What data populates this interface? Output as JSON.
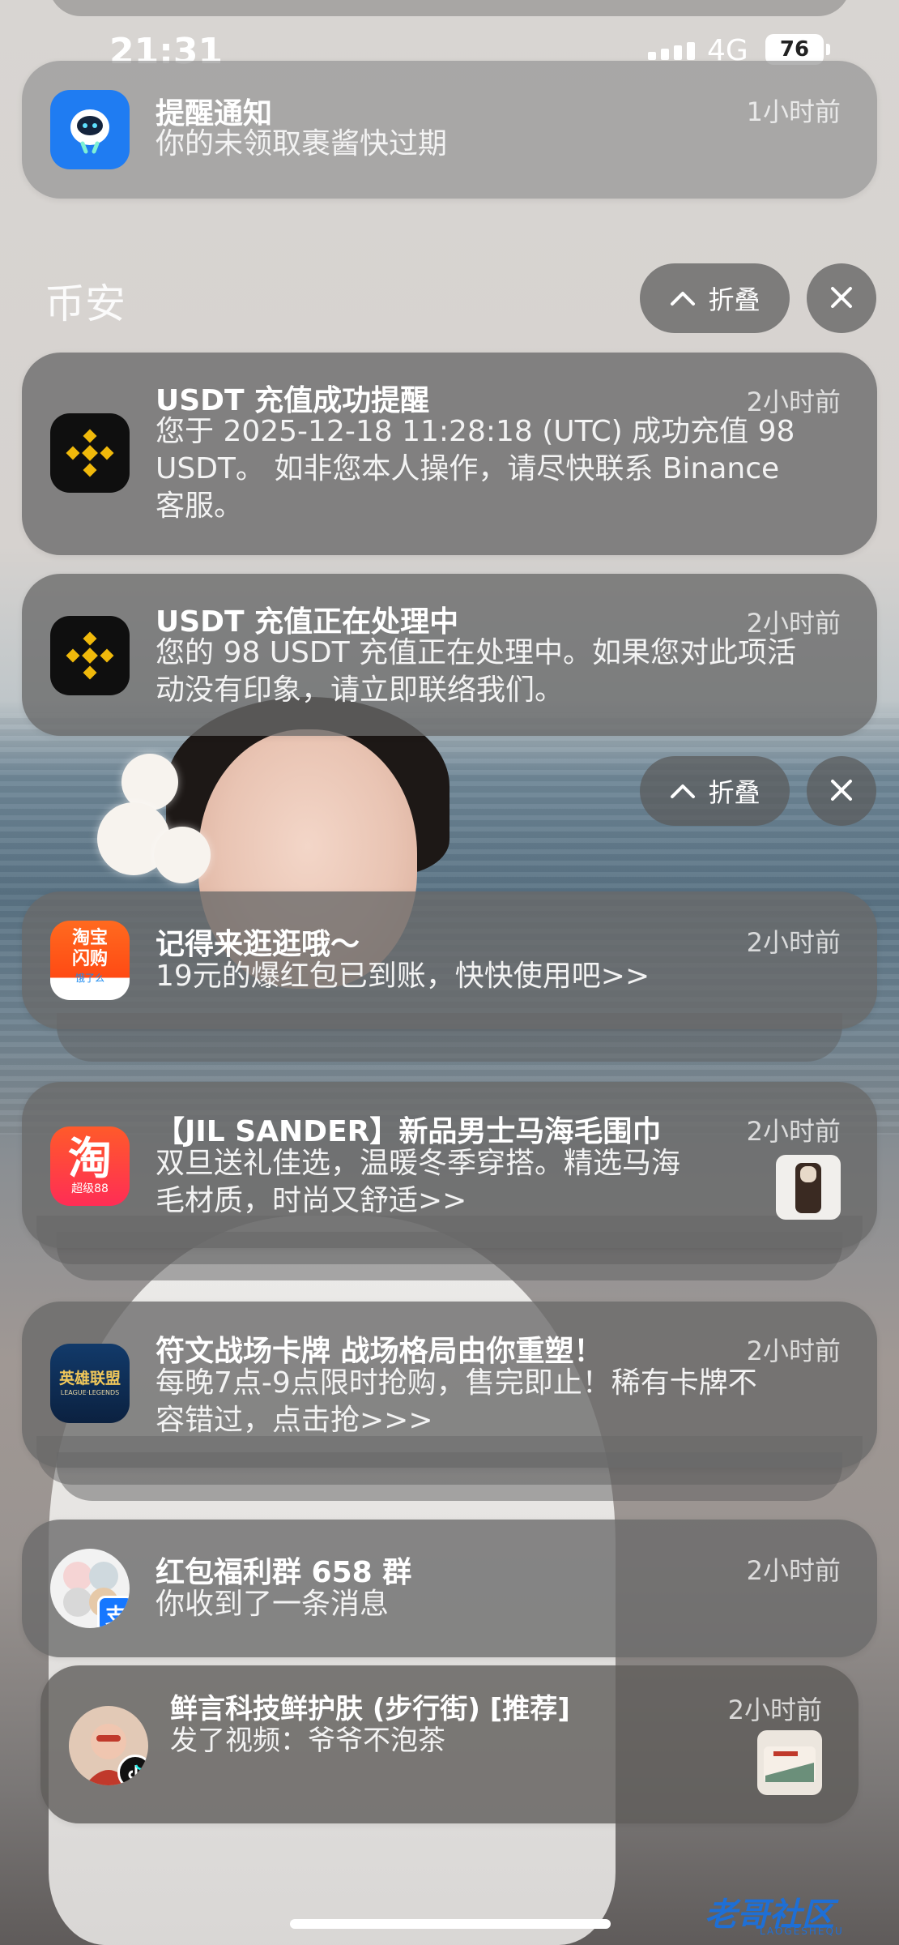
{
  "status_bar": {
    "time": "21:31",
    "network": "4G",
    "battery": "76"
  },
  "notifications": [
    {
      "app_icon": "bell-mascot-icon",
      "title": "提醒通知",
      "body": "你的未领取裹酱快过期",
      "time": "1小时前"
    },
    {
      "app_icon": "binance-icon",
      "title": "USDT 充值成功提醒",
      "body_lines": [
        "您于 2025-12-18 11:28:18 (UTC) 成功充值 98",
        "USDT。 如非您本人操作，请尽快联系 Binance",
        "客服。"
      ],
      "time": "2小时前"
    },
    {
      "app_icon": "binance-icon",
      "title": "USDT 充值正在处理中",
      "body_lines": [
        "您的 98 USDT 充值正在处理中。如果您对此项活",
        "动没有印象，请立即联络我们。"
      ],
      "time": "2小时前"
    },
    {
      "app_icon": "taobao-flash-icon",
      "title": "记得来逛逛哦～",
      "body": "19元的爆红包已到账，快快使用吧>>",
      "time": "2小时前"
    },
    {
      "app_icon": "taobao-icon",
      "title": "【JIL SANDER】新品男士马海毛围巾",
      "body_lines": [
        "双旦送礼佳选，温暖冬季穿搭。精选马海",
        "毛材质，时尚又舒适>>"
      ],
      "time": "2小时前"
    },
    {
      "app_icon": "league-of-legends-icon",
      "title": "符文战场卡牌 战场格局由你重塑！",
      "body_lines": [
        "每晚7点-9点限时抢购，售完即止！稀有卡牌不",
        "容错过，点击抢>>>"
      ],
      "time": "2小时前"
    },
    {
      "app_icon": "group-avatar-icon",
      "title": "红包福利群 658 群",
      "body": "你收到了一条消息",
      "time": "2小时前"
    },
    {
      "app_icon": "douyin-avatar-icon",
      "title": "鲜言科技鲜护肤 (步行街) [推荐]",
      "body": "发了视频：爷爷不泡茶",
      "time": "2小时前"
    }
  ],
  "group": {
    "title": "币安",
    "collapse_label": "折叠"
  },
  "group2": {
    "collapse_label": "折叠"
  },
  "icon_labels": {
    "taobao_flash_top": "淘宝",
    "taobao_flash_mid": "闪购",
    "taobao_flash_bot": "饿了么",
    "taobao_big": "淘",
    "taobao_sub": "超级88",
    "lol_cn": "英雄联盟",
    "lol_en": "LEAGUE·LEGENDS",
    "alipay_badge": "支"
  },
  "watermark": {
    "text": "老哥社区",
    "sub": "LAOGESHEQU"
  },
  "colors": {
    "binance_yellow": "#F0B90B",
    "taobao_orange": "#FF5A1F",
    "card_gray": "#6a6a6a"
  }
}
